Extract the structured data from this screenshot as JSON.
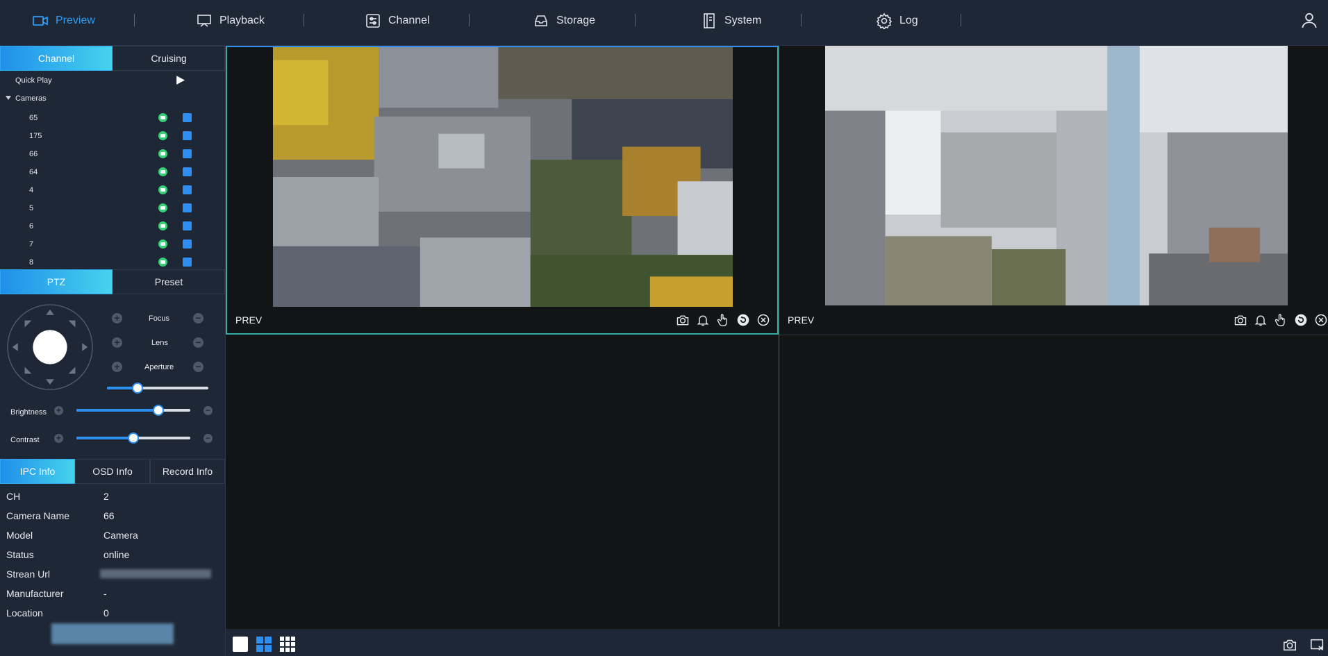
{
  "nav": {
    "items": [
      {
        "label": "Preview",
        "icon": "camera-icon",
        "active": true
      },
      {
        "label": "Playback",
        "icon": "playback-monitor-icon",
        "active": false
      },
      {
        "label": "Channel",
        "icon": "sliders-icon",
        "active": false
      },
      {
        "label": "Storage",
        "icon": "storage-tray-icon",
        "active": false
      },
      {
        "label": "System",
        "icon": "document-list-icon",
        "active": false
      },
      {
        "label": "Log",
        "icon": "gear-icon",
        "active": false
      }
    ],
    "accent": "#2f9cf4"
  },
  "sidebar": {
    "top_tabs": [
      {
        "label": "Channel",
        "active": true
      },
      {
        "label": "Cruising",
        "active": false
      }
    ],
    "quick_play": "Quick Play",
    "cameras_group": "Cameras",
    "cameras": [
      "65",
      "175",
      "66",
      "64",
      "4",
      "5",
      "6",
      "7",
      "8"
    ],
    "ptz_tabs": [
      {
        "label": "PTZ",
        "active": true
      },
      {
        "label": "Preset",
        "active": false
      }
    ],
    "ptz": {
      "focus": "Focus",
      "lens": "Lens",
      "aperture": "Aperture",
      "speed_level": 0.3,
      "brightness_label": "Brightness",
      "brightness_level": 0.72,
      "contrast_label": "Contrast",
      "contrast_level": 0.5
    },
    "info_tabs": [
      {
        "label": "IPC Info",
        "active": true
      },
      {
        "label": "OSD Info",
        "active": false
      },
      {
        "label": "Record Info",
        "active": false
      }
    ],
    "info": [
      {
        "key": "CH",
        "value": "2"
      },
      {
        "key": "Camera Name",
        "value": "66"
      },
      {
        "key": "Model",
        "value": "Camera"
      },
      {
        "key": "Status",
        "value": "online"
      },
      {
        "key": "Strean Url",
        "value": ""
      },
      {
        "key": "Manufacturer",
        "value": "-"
      },
      {
        "key": "Location",
        "value": "0"
      }
    ]
  },
  "panes": [
    {
      "label": "PREV"
    },
    {
      "label": "PREV"
    }
  ],
  "colors": {
    "panel": "#1e2736",
    "accent_blue": "#2f8ff0",
    "online_green": "#35d074",
    "active_border": "#3aa99f"
  }
}
